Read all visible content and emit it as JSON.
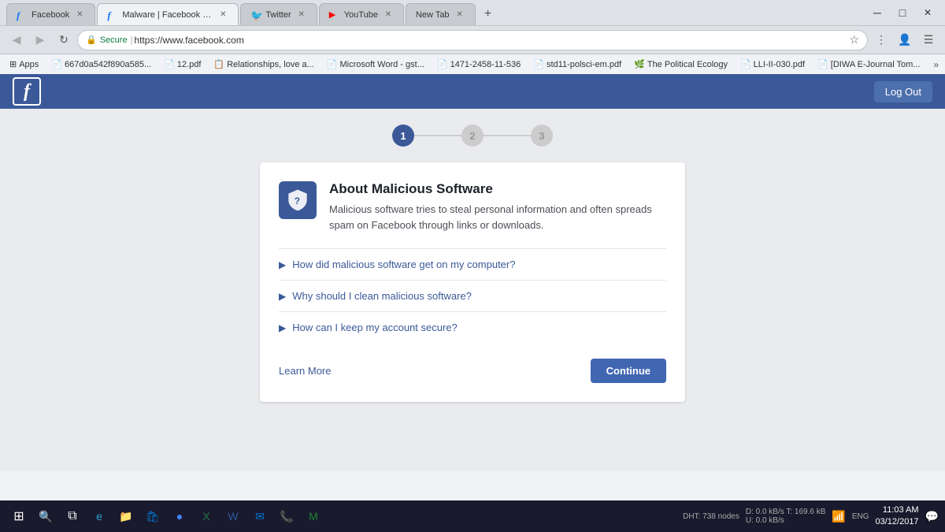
{
  "browser": {
    "tabs": [
      {
        "id": "tab-facebook",
        "label": "Facebook",
        "favicon": "fb",
        "active": false,
        "closable": true
      },
      {
        "id": "tab-malware",
        "label": "Malware | Facebook Help",
        "favicon": "fb",
        "active": true,
        "closable": true
      },
      {
        "id": "tab-twitter",
        "label": "Twitter",
        "favicon": "tw",
        "active": false,
        "closable": true
      },
      {
        "id": "tab-youtube",
        "label": "YouTube",
        "favicon": "yt",
        "active": false,
        "closable": true
      },
      {
        "id": "tab-newtab",
        "label": "New Tab",
        "favicon": "",
        "active": false,
        "closable": true
      }
    ],
    "address": "https://www.facebook.com",
    "secure_label": "Secure",
    "back_enabled": false,
    "forward_enabled": false
  },
  "bookmarks": {
    "apps_label": "Apps",
    "items": [
      {
        "label": "667d0a542f890a585...",
        "icon": "doc"
      },
      {
        "label": "12.pdf",
        "icon": "doc"
      },
      {
        "label": "Relationships, love a...",
        "icon": "doc-blue"
      },
      {
        "label": "Microsoft Word - gst...",
        "icon": "doc"
      },
      {
        "label": "1471-2458-11-536",
        "icon": "doc"
      },
      {
        "label": "std11-polsci-em.pdf",
        "icon": "doc"
      },
      {
        "label": "The Political Ecology",
        "icon": "leaf"
      },
      {
        "label": "LLI-II-030.pdf",
        "icon": "doc"
      },
      {
        "label": "[DIWA E-Journal Tom...",
        "icon": "doc"
      }
    ]
  },
  "facebook_header": {
    "logout_label": "Log Out"
  },
  "progress": {
    "steps": [
      {
        "number": "1",
        "active": true
      },
      {
        "number": "2",
        "active": false
      },
      {
        "number": "3",
        "active": false
      }
    ]
  },
  "card": {
    "title": "About Malicious Software",
    "description": "Malicious software tries to steal personal information and often spreads spam on Facebook through links or downloads.",
    "faq_items": [
      {
        "question": "How did malicious software get on my computer?"
      },
      {
        "question": "Why should I clean malicious software?"
      },
      {
        "question": "How can I keep my account secure?"
      }
    ],
    "learn_more_label": "Learn More",
    "continue_label": "Continue"
  },
  "taskbar": {
    "time": "11:03 AM",
    "date": "03/12/2017",
    "dht": "DHT: 738 nodes",
    "download": "D: 0.0 kB/s T: 169.6 kB",
    "upload": "U: 0.0 kB/s",
    "lang": "ENG",
    "icons": [
      "windows",
      "search",
      "task-view",
      "edge",
      "files",
      "store",
      "chrome",
      "excel",
      "word",
      "mail",
      "viber",
      "mail2"
    ]
  }
}
